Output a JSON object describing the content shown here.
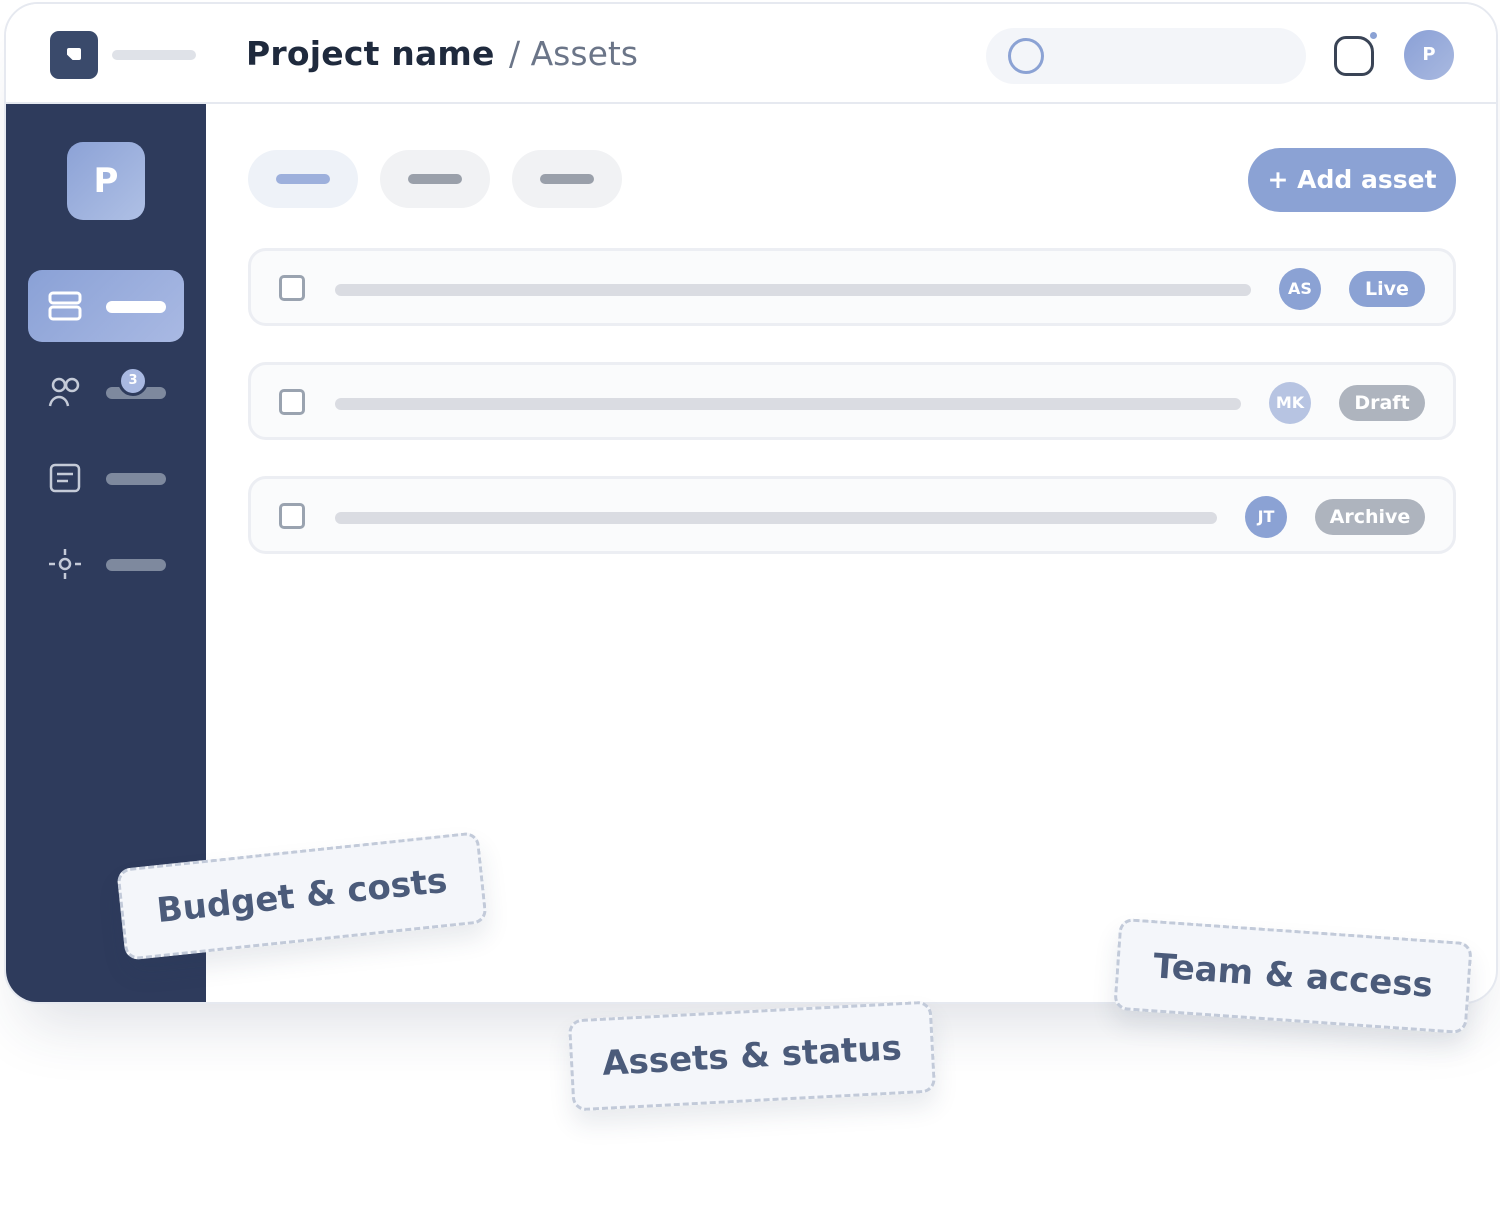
{
  "header": {
    "project_name": "Project name",
    "breadcrumb": "/ Assets",
    "avatar_initial": "P",
    "icons": {
      "logo": "logo-icon",
      "search": "search-icon",
      "notification": "bell-icon"
    }
  },
  "sidebar": {
    "logo_initial": "P",
    "items": [
      {
        "icon": "cards-icon",
        "active": true
      },
      {
        "icon": "team-icon",
        "active": false,
        "badge": "3"
      },
      {
        "icon": "document-icon",
        "active": false
      },
      {
        "icon": "settings-icon",
        "active": false
      }
    ]
  },
  "toolbar": {
    "add_button_label": "+ Add asset"
  },
  "assets": [
    {
      "initials": "AS",
      "status": "Live",
      "avatar_color": "#8ba2d4",
      "status_color": "#8ba2d4"
    },
    {
      "initials": "MK",
      "status": "Draft",
      "avatar_color": "#b7c4e2",
      "status_color": "#aeb4be"
    },
    {
      "initials": "JT",
      "status": "Archive",
      "avatar_color": "#8ba2d4",
      "status_color": "#aeb4be"
    }
  ],
  "feature_cards": {
    "budget": "Budget & costs",
    "assets": "Assets & status",
    "team": "Team & access"
  },
  "colors": {
    "accent": "#8ba2d4",
    "sidebar": "#2e3b5c",
    "text_dark": "#1f2a3d"
  }
}
